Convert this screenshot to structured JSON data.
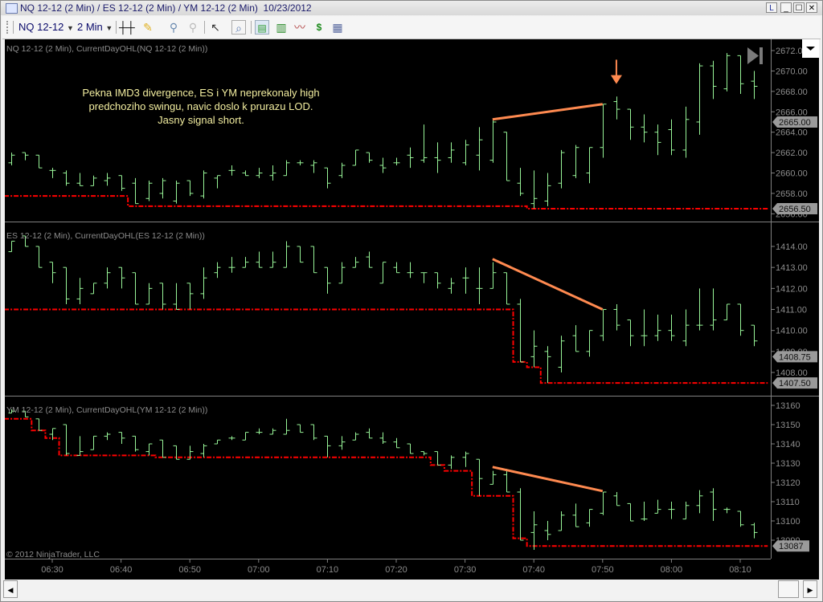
{
  "window": {
    "title": "NQ 12-12 (2 Min) / ES 12-12 (2 Min) / YM 12-12 (2 Min)  10/23/2012",
    "buttons": {
      "link": "L",
      "minimize": "_",
      "maximize": "☐",
      "close": "✕"
    }
  },
  "toolbar": {
    "instrument": "NQ 12-12",
    "interval": "2 Min",
    "icons": [
      "bar-type-icon",
      "drawing-pencil-icon",
      "zoom-in-icon",
      "zoom-out-icon",
      "pointer-icon",
      "zoom-box-icon",
      "data-series-icon",
      "chart-style-icon",
      "indicators-icon",
      "strategies-icon",
      "properties-icon"
    ]
  },
  "annotation": {
    "lines": [
      "Pekna IMD3 divergence, ES i YM neprekonaly high",
      "predchoziho swingu, navic doslo k prurazu LOD.",
      "Jasny signal short."
    ],
    "text_color": "#f3eea0",
    "trend_color": "#ff8a50"
  },
  "copyright": "© 2012 NinjaTrader, LLC",
  "colors": {
    "bar": "#98f598",
    "lod": "#ff0000",
    "axis_text": "#8c8c8c",
    "marker_bg": "#9a9a9a"
  },
  "time_axis": {
    "labels": [
      "06:30",
      "06:40",
      "06:50",
      "07:00",
      "07:10",
      "07:20",
      "07:30",
      "07:40",
      "07:50",
      "08:00",
      "08:10"
    ]
  },
  "chart_data": [
    {
      "type": "ohlc",
      "title": "NQ 12-12 (2 Min), CurrentDayOHL(NQ 12-12 (2 Min))",
      "start_time": "06:24",
      "bar_minutes": 2,
      "bars_ohlc": [
        [
          2661.0,
          2662.0,
          2660.75,
          2661.75
        ],
        [
          2662.0,
          2662.0,
          2661.25,
          2661.75
        ],
        [
          2661.75,
          2661.75,
          2660.5,
          2660.5
        ],
        [
          2660.25,
          2660.5,
          2659.5,
          2660.25
        ],
        [
          2660.0,
          2660.25,
          2658.75,
          2659.0
        ],
        [
          2659.0,
          2660.0,
          2658.75,
          2658.75
        ],
        [
          2658.75,
          2659.75,
          2658.75,
          2659.5
        ],
        [
          2659.25,
          2660.0,
          2658.75,
          2659.5
        ],
        [
          2659.75,
          2659.75,
          2658.25,
          2658.5
        ],
        [
          2659.0,
          2659.5,
          2657.0,
          2657.0
        ],
        [
          2657.5,
          2659.25,
          2657.25,
          2659.0
        ],
        [
          2658.0,
          2659.5,
          2657.5,
          2659.25
        ],
        [
          2657.25,
          2659.25,
          2657.0,
          2659.0
        ],
        [
          2659.25,
          2659.25,
          2657.75,
          2658.0
        ],
        [
          2657.75,
          2660.25,
          2657.5,
          2660.0
        ],
        [
          2659.5,
          2659.75,
          2658.5,
          2659.75
        ],
        [
          2660.25,
          2660.75,
          2659.75,
          2660.25
        ],
        [
          2660.0,
          2660.25,
          2659.75,
          2659.75
        ],
        [
          2659.75,
          2660.5,
          2659.5,
          2660.0
        ],
        [
          2659.75,
          2660.75,
          2659.25,
          2660.0
        ],
        [
          2659.75,
          2661.25,
          2659.75,
          2661.0
        ],
        [
          2661.0,
          2661.25,
          2660.75,
          2661.0
        ],
        [
          2660.75,
          2661.25,
          2660.0,
          2661.0
        ],
        [
          2660.5,
          2660.5,
          2658.5,
          2659.0
        ],
        [
          2659.75,
          2661.0,
          2659.5,
          2660.75
        ],
        [
          2660.75,
          2662.25,
          2660.75,
          2662.25
        ],
        [
          2662.0,
          2662.0,
          2661.0,
          2661.25
        ],
        [
          2660.75,
          2661.5,
          2660.0,
          2660.5
        ],
        [
          2661.0,
          2661.5,
          2660.75,
          2661.0
        ],
        [
          2661.75,
          2662.5,
          2660.5,
          2661.5
        ],
        [
          2661.25,
          2664.75,
          2661.0,
          2661.5
        ],
        [
          2661.5,
          2663.0,
          2660.0,
          2661.25
        ],
        [
          2661.5,
          2663.0,
          2661.0,
          2662.25
        ],
        [
          2661.0,
          2663.25,
          2660.75,
          2662.75
        ],
        [
          2661.75,
          2664.5,
          2660.25,
          2663.25
        ],
        [
          2661.25,
          2665.25,
          2661.0,
          2665.0
        ],
        [
          2664.0,
          2664.0,
          2659.25,
          2659.25
        ],
        [
          2659.0,
          2660.5,
          2657.75,
          2658.0
        ],
        [
          2657.0,
          2660.25,
          2656.5,
          2657.5
        ],
        [
          2657.25,
          2660.0,
          2656.75,
          2658.75
        ],
        [
          2659.0,
          2662.25,
          2658.5,
          2662.0
        ],
        [
          2659.75,
          2662.75,
          2659.5,
          2662.5
        ],
        [
          2660.0,
          2662.5,
          2659.0,
          2662.5
        ],
        [
          2662.5,
          2666.75,
          2661.5,
          2666.75
        ],
        [
          2667.0,
          2667.5,
          2665.25,
          2666.25
        ],
        [
          2666.25,
          2666.25,
          2663.25,
          2664.5
        ],
        [
          2664.5,
          2665.75,
          2663.0,
          2664.0
        ],
        [
          2664.0,
          2664.75,
          2661.75,
          2663.0
        ],
        [
          2664.25,
          2665.25,
          2661.75,
          2662.25
        ],
        [
          2662.25,
          2666.5,
          2661.5,
          2665.25
        ],
        [
          2665.0,
          2670.75,
          2663.75,
          2670.5
        ],
        [
          2670.5,
          2671.0,
          2667.25,
          2668.5
        ],
        [
          2668.25,
          2671.75,
          2668.0,
          2671.5
        ],
        [
          2671.5,
          2671.5,
          2667.75,
          2668.75
        ],
        [
          2669.0,
          2670.0,
          2667.25,
          2668.5
        ]
      ],
      "lod_steps": [
        [
          "06:23",
          2657.75
        ],
        [
          "06:41",
          2656.75
        ],
        [
          "07:39",
          2656.5
        ],
        [
          "08:14",
          2656.5
        ]
      ],
      "y_ticks": [
        "2656.00",
        "2658.00",
        "2660.00",
        "2662.00",
        "2664.00",
        "2666.00",
        "2668.00",
        "2670.00",
        "2672.00"
      ],
      "price_markers": [
        "2665.00",
        "2656.50"
      ],
      "trend_line": [
        [
          "07:34",
          2665.25
        ],
        [
          "07:50",
          2666.75
        ]
      ],
      "arrow": {
        "time": "07:52",
        "from": 2671.1,
        "to": 2668.8
      }
    },
    {
      "type": "ohlc",
      "title": "ES 12-12 (2 Min), CurrentDayOHL(ES 12-12 (2 Min))",
      "start_time": "06:24",
      "bar_minutes": 2,
      "bars_ohlc": [
        [
          1413.75,
          1414.25,
          1413.75,
          1414.25
        ],
        [
          1414.5,
          1414.5,
          1414.0,
          1414.0
        ],
        [
          1414.0,
          1414.0,
          1413.0,
          1413.0
        ],
        [
          1413.25,
          1413.25,
          1412.25,
          1412.75
        ],
        [
          1413.0,
          1413.0,
          1411.25,
          1411.5
        ],
        [
          1411.5,
          1412.5,
          1411.25,
          1412.0
        ],
        [
          1411.75,
          1412.25,
          1411.75,
          1412.25
        ],
        [
          1412.25,
          1413.0,
          1412.0,
          1412.75
        ],
        [
          1413.0,
          1413.0,
          1412.0,
          1412.5
        ],
        [
          1412.75,
          1412.75,
          1411.25,
          1411.25
        ],
        [
          1411.25,
          1412.25,
          1411.25,
          1412.0
        ],
        [
          1412.25,
          1412.25,
          1411.0,
          1411.25
        ],
        [
          1411.25,
          1412.25,
          1411.0,
          1411.0
        ],
        [
          1412.25,
          1412.25,
          1411.0,
          1411.75
        ],
        [
          1411.75,
          1413.0,
          1411.5,
          1412.5
        ],
        [
          1412.75,
          1413.25,
          1412.5,
          1413.0
        ],
        [
          1413.0,
          1413.5,
          1412.75,
          1413.0
        ],
        [
          1413.0,
          1413.5,
          1413.0,
          1413.25
        ],
        [
          1413.25,
          1413.75,
          1413.0,
          1413.0
        ],
        [
          1413.0,
          1413.75,
          1413.0,
          1413.25
        ],
        [
          1413.0,
          1414.25,
          1413.0,
          1414.0
        ],
        [
          1414.0,
          1414.0,
          1413.25,
          1413.25
        ],
        [
          1414.0,
          1414.0,
          1412.75,
          1412.75
        ],
        [
          1413.0,
          1413.0,
          1411.75,
          1412.25
        ],
        [
          1412.25,
          1413.25,
          1412.25,
          1413.0
        ],
        [
          1413.0,
          1413.5,
          1413.0,
          1413.25
        ],
        [
          1413.5,
          1413.75,
          1413.0,
          1413.0
        ],
        [
          1412.25,
          1413.25,
          1412.25,
          1413.25
        ],
        [
          1413.0,
          1413.25,
          1412.75,
          1412.75
        ],
        [
          1412.75,
          1413.25,
          1412.5,
          1412.75
        ],
        [
          1412.75,
          1412.75,
          1412.25,
          1412.75
        ],
        [
          1412.75,
          1412.75,
          1412.0,
          1412.25
        ],
        [
          1412.0,
          1412.5,
          1411.75,
          1412.25
        ],
        [
          1412.5,
          1413.0,
          1411.75,
          1412.5
        ],
        [
          1412.0,
          1413.0,
          1411.25,
          1412.0
        ],
        [
          1412.0,
          1413.25,
          1412.0,
          1412.75
        ],
        [
          1412.75,
          1412.75,
          1411.25,
          1411.25
        ],
        [
          1411.25,
          1411.5,
          1408.5,
          1408.5
        ],
        [
          1408.75,
          1410.0,
          1408.25,
          1409.25
        ],
        [
          1409.0,
          1409.25,
          1407.5,
          1408.75
        ],
        [
          1408.25,
          1409.75,
          1408.0,
          1409.5
        ],
        [
          1409.75,
          1410.25,
          1409.0,
          1409.0
        ],
        [
          1409.0,
          1410.0,
          1408.75,
          1410.0
        ],
        [
          1409.75,
          1411.0,
          1409.5,
          1411.0
        ],
        [
          1411.0,
          1411.25,
          1410.0,
          1410.25
        ],
        [
          1410.5,
          1410.5,
          1409.25,
          1409.75
        ],
        [
          1409.75,
          1411.0,
          1409.25,
          1409.75
        ],
        [
          1409.75,
          1410.75,
          1409.5,
          1410.0
        ],
        [
          1410.0,
          1410.75,
          1409.5,
          1409.75
        ],
        [
          1409.5,
          1411.0,
          1409.25,
          1410.25
        ],
        [
          1410.25,
          1412.0,
          1410.0,
          1410.25
        ],
        [
          1410.25,
          1412.0,
          1410.0,
          1410.5
        ],
        [
          1410.5,
          1411.25,
          1410.5,
          1411.25
        ],
        [
          1411.25,
          1411.25,
          1409.75,
          1410.0
        ],
        [
          1410.25,
          1410.25,
          1409.25,
          1409.5
        ]
      ],
      "lod_steps": [
        [
          "06:23",
          1411.0
        ],
        [
          "07:37",
          1408.5
        ],
        [
          "07:39",
          1408.25
        ],
        [
          "07:41",
          1407.5
        ],
        [
          "08:14",
          1407.5
        ]
      ],
      "y_ticks": [
        "1408.00",
        "1409.00",
        "1410.00",
        "1411.00",
        "1412.00",
        "1413.00",
        "1414.00"
      ],
      "price_markers": [
        "1408.75",
        "1407.50"
      ],
      "trend_line": [
        [
          "07:34",
          1413.4
        ],
        [
          "07:50",
          1411.0
        ]
      ]
    },
    {
      "type": "ohlc",
      "title": "YM 12-12 (2 Min), CurrentDayOHL(YM 12-12 (2 Min))",
      "start_time": "06:24",
      "bar_minutes": 2,
      "bars_ohlc": [
        [
          13156,
          13158,
          13156,
          13157
        ],
        [
          13157,
          13157,
          13154,
          13154
        ],
        [
          13153,
          13153,
          13147,
          13147
        ],
        [
          13145,
          13148,
          13142,
          13148
        ],
        [
          13150,
          13150,
          13134,
          13135
        ],
        [
          13134,
          13144,
          13134,
          13136
        ],
        [
          13137,
          13144,
          13137,
          13144
        ],
        [
          13144,
          13146,
          13142,
          13145
        ],
        [
          13146,
          13146,
          13140,
          13143
        ],
        [
          13144,
          13144,
          13136,
          13137
        ],
        [
          13136,
          13140,
          13134,
          13140
        ],
        [
          13142,
          13142,
          13133,
          13133
        ],
        [
          13139,
          13139,
          13132,
          13132
        ],
        [
          13132,
          13139,
          13132,
          13136
        ],
        [
          13135,
          13140,
          13133,
          13139
        ],
        [
          13140,
          13142,
          13140,
          13142
        ],
        [
          13143,
          13144,
          13142,
          13143
        ],
        [
          13142,
          13146,
          13142,
          13146
        ],
        [
          13146,
          13148,
          13145,
          13146
        ],
        [
          13145,
          13148,
          13145,
          13147
        ],
        [
          13145,
          13153,
          13145,
          13147
        ],
        [
          13150,
          13150,
          13146,
          13146
        ],
        [
          13150,
          13150,
          13142,
          13143
        ],
        [
          13144,
          13144,
          13133,
          13139
        ],
        [
          13139,
          13144,
          13137,
          13141
        ],
        [
          13142,
          13146,
          13142,
          13145
        ],
        [
          13146,
          13148,
          13143,
          13143
        ],
        [
          13143,
          13146,
          13140,
          13141
        ],
        [
          13141,
          13143,
          13138,
          13138
        ],
        [
          13140,
          13140,
          13135,
          13135
        ],
        [
          13136,
          13136,
          13134,
          13135
        ],
        [
          13136,
          13136,
          13129,
          13129
        ],
        [
          13129,
          13134,
          13127,
          13133
        ],
        [
          13133,
          13136,
          13128,
          13135
        ],
        [
          13132,
          13132,
          13113,
          13122
        ],
        [
          13119,
          13126,
          13119,
          13124
        ],
        [
          13124,
          13127,
          13115,
          13115
        ],
        [
          13115,
          13117,
          13090,
          13090
        ],
        [
          13094,
          13105,
          13085,
          13098
        ],
        [
          13095,
          13100,
          13090,
          13093
        ],
        [
          13095,
          13105,
          13095,
          13103
        ],
        [
          13103,
          13109,
          13097,
          13097
        ],
        [
          13099,
          13106,
          13097,
          13106
        ],
        [
          13104,
          13115,
          13103,
          13115
        ],
        [
          13113,
          13115,
          13108,
          13108
        ],
        [
          13109,
          13109,
          13100,
          13100
        ],
        [
          13101,
          13110,
          13100,
          13101
        ],
        [
          13104,
          13111,
          13104,
          13106
        ],
        [
          13106,
          13110,
          13101,
          13106
        ],
        [
          13101,
          13110,
          13101,
          13108
        ],
        [
          13108,
          13116,
          13104,
          13113
        ],
        [
          13115,
          13117,
          13100,
          13106
        ],
        [
          13106,
          13107,
          13104,
          13106
        ],
        [
          13105,
          13105,
          13097,
          13098
        ],
        [
          13098,
          13099,
          13091,
          13094
        ]
      ],
      "lod_steps": [
        [
          "06:23",
          13153
        ],
        [
          "06:27",
          13147
        ],
        [
          "06:29",
          13143
        ],
        [
          "06:31",
          13134
        ],
        [
          "06:45",
          13133
        ],
        [
          "07:25",
          13129
        ],
        [
          "07:27",
          13126
        ],
        [
          "07:31",
          13113
        ],
        [
          "07:37",
          13091
        ],
        [
          "07:39",
          13087
        ],
        [
          "08:14",
          13087
        ]
      ],
      "y_ticks": [
        "13090",
        "13100",
        "13110",
        "13120",
        "13130",
        "13140",
        "13150",
        "13160"
      ],
      "price_markers": [
        "13087"
      ],
      "trend_line": [
        [
          "07:34",
          13128
        ],
        [
          "07:50",
          13115.5
        ]
      ]
    }
  ]
}
